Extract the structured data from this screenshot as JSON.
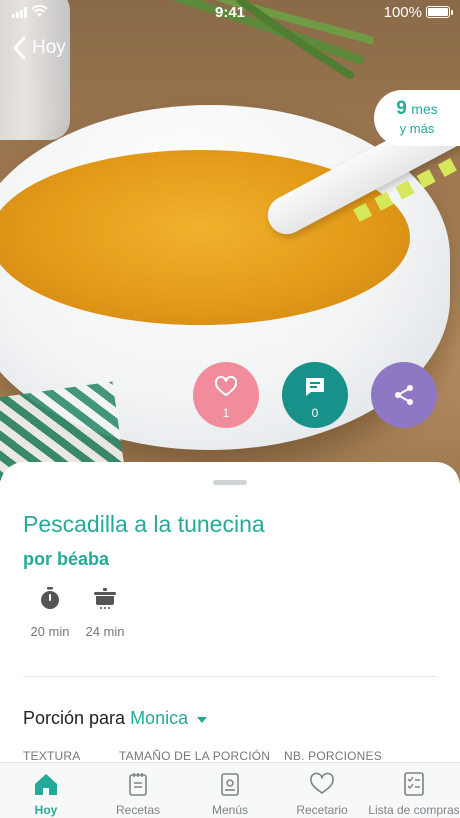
{
  "status_bar": {
    "time": "9:41",
    "battery": "100%"
  },
  "nav": {
    "back_label": "Hoy"
  },
  "age_badge": {
    "number": "9",
    "unit": "mes",
    "suffix": "y más"
  },
  "actions": {
    "likes": "1",
    "comments": "0"
  },
  "recipe": {
    "title": "Pescadilla a la tunecina",
    "author": "por béaba",
    "prep_time": "20 min",
    "cook_time": "24 min"
  },
  "portion": {
    "label": "Porción para",
    "person": "Monica",
    "columns": [
      "TEXTURA",
      "TAMAÑO DE LA PORCIÓN",
      "NB. PORCIONES"
    ]
  },
  "tabbar": {
    "items": [
      {
        "label": "Hoy",
        "icon": "home-icon",
        "active": true
      },
      {
        "label": "Recetas",
        "icon": "recipes-icon",
        "active": false
      },
      {
        "label": "Menús",
        "icon": "menus-icon",
        "active": false
      },
      {
        "label": "Recetario",
        "icon": "heart-icon",
        "active": false
      },
      {
        "label": "Lista de compras",
        "icon": "checklist-icon",
        "active": false
      }
    ]
  },
  "colors": {
    "accent": "#26a99a",
    "like": "#f08c9b",
    "comment": "#17918a",
    "share": "#8e78c4"
  }
}
